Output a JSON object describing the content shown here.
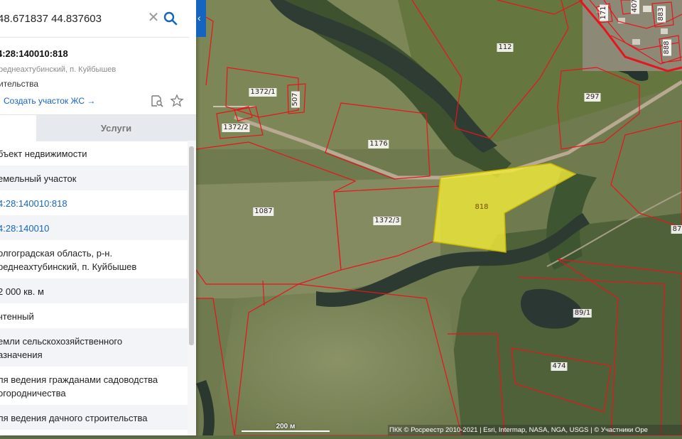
{
  "search": {
    "value": "48.671837 44.837603"
  },
  "object": {
    "cad_number": "4:28:140010:818",
    "address_short": "реднеахтубинский, п. Куйбышев",
    "purpose_short": "ительства",
    "create_link": "Создать участок ЖС →"
  },
  "tabs": {
    "services": "Услуги"
  },
  "attributes": [
    {
      "text": "бъект недвижимости",
      "link": false
    },
    {
      "text": "емельный участок",
      "link": false
    },
    {
      "text": "4:28:140010:818",
      "link": true
    },
    {
      "text": "4:28:140010",
      "link": true
    },
    {
      "text": "олгоградская область, р-н.",
      "text2": "реднеахтубинский, п. Куйбышев",
      "link": false
    },
    {
      "text": "2 000 кв. м",
      "link": false
    },
    {
      "text": "чтенный",
      "link": false
    },
    {
      "text": "емли сельскохозяйственного",
      "text2": "азначения",
      "link": false
    },
    {
      "text": "ля ведения гражданами садоводства",
      "text2": " огородничества",
      "link": false
    },
    {
      "text": "ля ведения дачного строительства",
      "link": false
    }
  ],
  "map": {
    "plot_labels": [
      "112",
      "1372/1",
      "507",
      "297",
      "1372/2",
      "1176",
      "818",
      "1087",
      "1372/3",
      "87",
      "89/1",
      "474",
      "171",
      "407",
      "883",
      "888"
    ],
    "selected_plot": "818",
    "colors": {
      "boundary": "#e8141b",
      "selected_fill": "#f2ea3a",
      "accent": "#1565c0"
    }
  },
  "scale": {
    "label": "200 м"
  },
  "attribution": "ПКК © Росреестр 2010-2021 | Esri, Intermap, NASA, NGA, USGS | © Участники Ope"
}
